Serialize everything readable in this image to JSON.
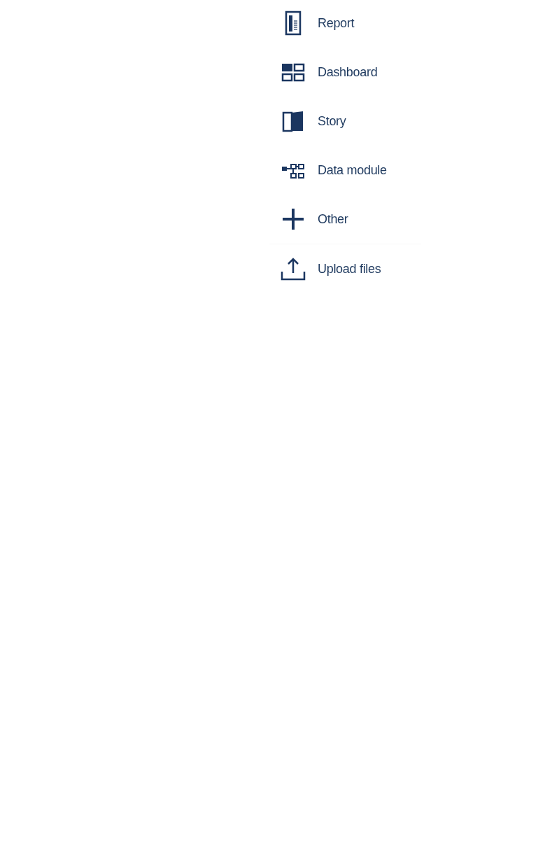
{
  "menu": {
    "items": [
      {
        "kind": "report",
        "label": "Report"
      },
      {
        "kind": "dashboard",
        "label": "Dashboard"
      },
      {
        "kind": "story",
        "label": "Story"
      },
      {
        "kind": "data-module",
        "label": "Data module"
      },
      {
        "kind": "other",
        "label": "Other"
      }
    ],
    "footer_items": [
      {
        "kind": "upload",
        "label": "Upload files"
      }
    ]
  }
}
